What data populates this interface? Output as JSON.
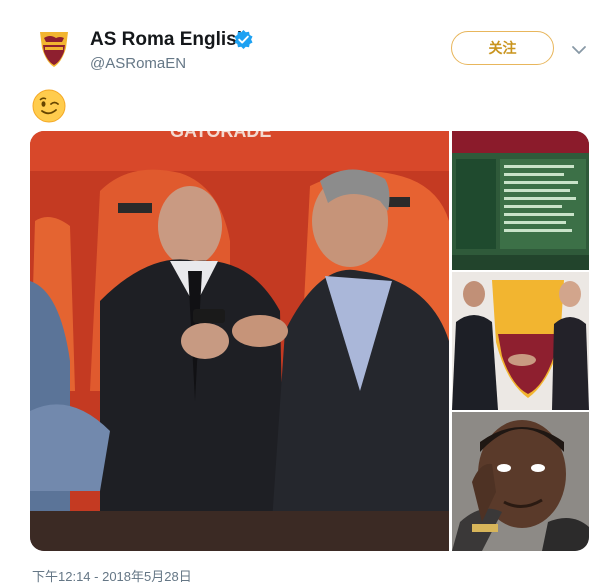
{
  "tweet": {
    "display_name": "AS Roma English",
    "handle": "@ASRomaEN",
    "follow_label": "关注",
    "emoji": "winking-face",
    "timestamp": "下午12:14 - 2018年5月28日",
    "verified": true,
    "accent_color": "#c9941e"
  },
  "media": {
    "main_photo": {
      "description": "photo",
      "visible_text": "GATORADE"
    },
    "side_photos": [
      "football-manager-screenshot",
      "crest-signing-photo",
      "tapping-head-meme"
    ]
  }
}
